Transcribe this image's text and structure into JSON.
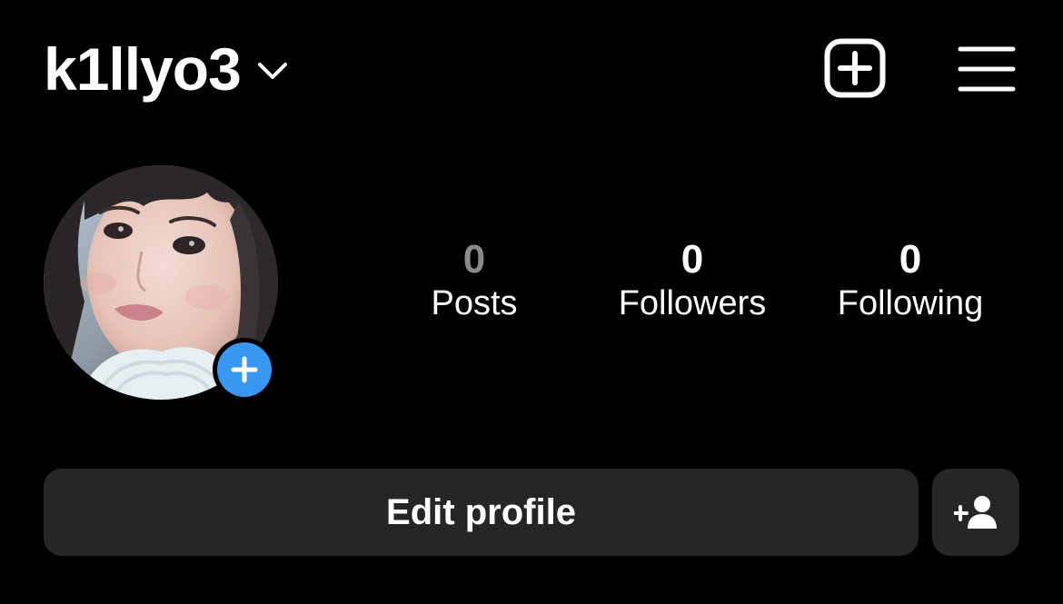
{
  "header": {
    "username": "k1llyo3",
    "switcher_icon": "chevron-down-icon",
    "create_icon": "plus-square-icon",
    "menu_icon": "hamburger-menu-icon"
  },
  "profile": {
    "avatar_icon": "profile-photo",
    "add_story_icon": "plus-icon",
    "add_story_color": "#3897f0"
  },
  "stats": {
    "posts": {
      "count": "0",
      "label": "Posts"
    },
    "followers": {
      "count": "0",
      "label": "Followers"
    },
    "following": {
      "count": "0",
      "label": "Following"
    }
  },
  "actions": {
    "edit_profile_label": "Edit profile",
    "discover_people_icon": "add-person-icon"
  },
  "colors": {
    "background": "#000000",
    "button_bg": "#262626",
    "muted_count": "#8a8a8a"
  }
}
